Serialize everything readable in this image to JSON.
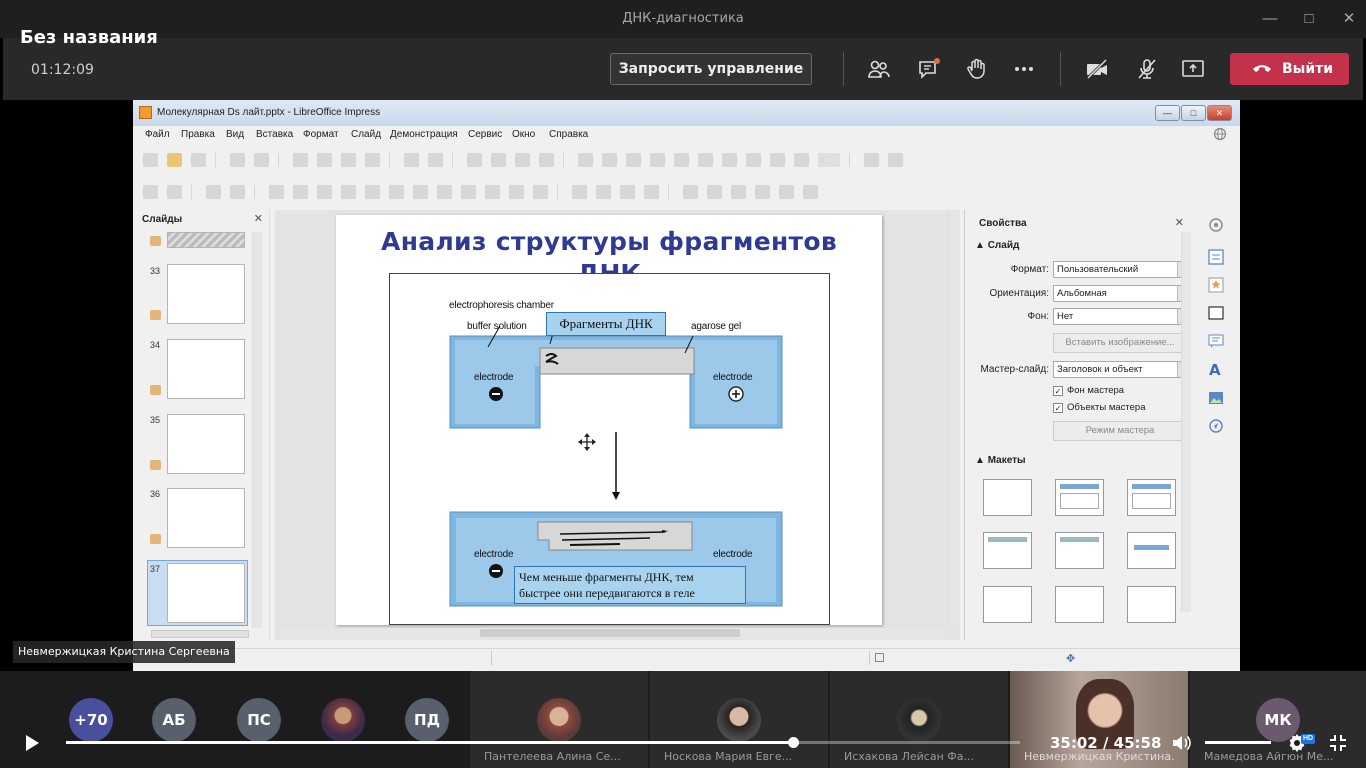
{
  "window": {
    "title": "ДНК-диагностика"
  },
  "video": {
    "title": "Без названия"
  },
  "meeting": {
    "elapsed": "01:12:09",
    "request_control": "Запросить управление",
    "leave": "Выйти"
  },
  "lo": {
    "title": "Молекулярная Ds лайт.pptx - LibreOffice Impress",
    "menu": [
      "Файл",
      "Правка",
      "Вид",
      "Вставка",
      "Формат",
      "Слайд",
      "Демонстрация",
      "Сервис",
      "Окно",
      "Справка"
    ],
    "slides_header": "Слайды",
    "slide_numbers": [
      "33",
      "34",
      "35",
      "36",
      "37"
    ],
    "properties_header": "Свойства",
    "section_slide": "Слайд",
    "format_label": "Формат:",
    "format_value": "Пользовательский",
    "orientation_label": "Ориентация:",
    "orientation_value": "Альбомная",
    "background_label": "Фон:",
    "background_value": "Нет",
    "insert_image": "Вставить изображение...",
    "master_label": "Мастер-слайд:",
    "master_value": "Заголовок и объект",
    "master_bg": "Фон мастера",
    "master_objects": "Объекты мастера",
    "master_mode": "Режим мастера",
    "section_layouts": "Макеты"
  },
  "slide": {
    "title": "Анализ структуры фрагментов",
    "title_line2": "ДНК",
    "labels": {
      "chamber": "electrophoresis chamber",
      "buffer": "buffer solution",
      "gel": "agarose gel",
      "electrode": "electrode"
    },
    "callout_fragments": "Фрагменты ДНК",
    "callout_note_1": "Чем меньше фрагменты ДНК, тем",
    "callout_note_2": "быстрее они передвигаются в геле"
  },
  "presenter": {
    "name": "Невмержицкая Кристина Сергеевна"
  },
  "participants": {
    "avatars": [
      "+70",
      "АБ",
      "ПС",
      "ПД",
      "МК"
    ],
    "tiles": [
      "Пантелеева Алина Се...",
      "Носкова Мария Евге...",
      "Исхакова Лейсан Фа...",
      "Невмержицкая Кристина...",
      "Мамедова Айгюн Ме..."
    ]
  },
  "player": {
    "time": "35:02 / 45:58",
    "progress": 0.762,
    "hd": "HD"
  },
  "colors": {
    "leave": "#c4314b",
    "slide_title": "#2e3a93",
    "buffer_blue": "#7fb6e1",
    "callout_bg": "#a8d3ef"
  },
  "icons": [
    "people-icon",
    "chat-icon",
    "raise-hand-icon",
    "more-icon",
    "camera-off-icon",
    "mic-off-icon",
    "share-icon",
    "phone-icon",
    "play-icon",
    "volume-icon",
    "settings-icon",
    "exit-fullscreen-icon"
  ]
}
